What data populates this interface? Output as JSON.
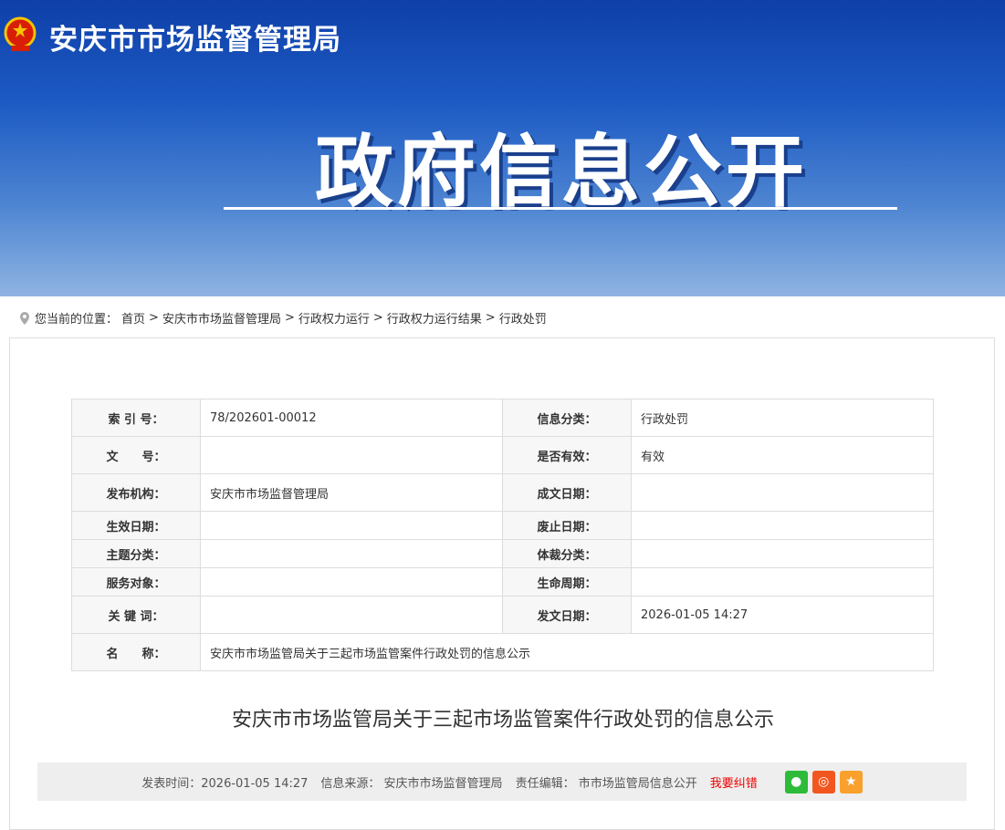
{
  "header": {
    "site_name": "安庆市市场监督管理局",
    "banner_title": "政府信息公开"
  },
  "breadcrumb": {
    "prefix": "您当前的位置：",
    "items": [
      "首页",
      "安庆市市场监督管理局",
      "行政权力运行",
      "行政权力运行结果",
      "行政处罚"
    ],
    "sep": ">"
  },
  "meta": [
    {
      "k1": "索 引 号：",
      "v1": "78/202601-00012",
      "k2": "信息分类：",
      "v2": "行政处罚"
    },
    {
      "k1": "文　　号：",
      "v1": "",
      "k2": "是否有效：",
      "v2": "有效"
    },
    {
      "k1": "发布机构：",
      "v1": "安庆市市场监督管理局",
      "k2": "成文日期：",
      "v2": ""
    },
    {
      "k1": "生效日期：",
      "v1": "",
      "k2": "废止日期：",
      "v2": ""
    },
    {
      "k1": "主题分类：",
      "v1": "",
      "k2": "体裁分类：",
      "v2": ""
    },
    {
      "k1": "服务对象：",
      "v1": "",
      "k2": "生命周期：",
      "v2": ""
    },
    {
      "k1": "关 键 词：",
      "v1": "",
      "k2": "发文日期：",
      "v2": "2026-01-05 14:27"
    },
    {
      "k1": "名　　称：",
      "v1": "安庆市市场监管局关于三起市场监管案件行政处罚的信息公示"
    }
  ],
  "article": {
    "title": "安庆市市场监管局关于三起市场监管案件行政处罚的信息公示",
    "publish": "发表时间：2026-01-05 14:27",
    "source": "信息来源： 安庆市市场监督管理局",
    "editor": "责任编辑： 市市场监管局信息公开",
    "report": "我要纠错"
  },
  "colors": {
    "wechat": "#2dbb39",
    "weibo": "#f2561f",
    "fav": "#f9a12c"
  }
}
